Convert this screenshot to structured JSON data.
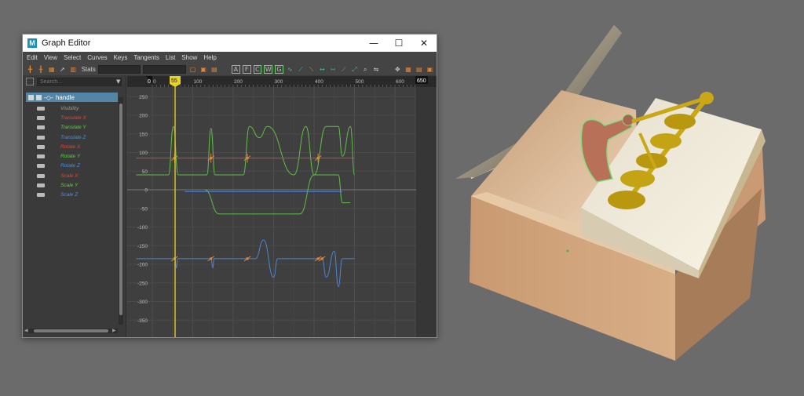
{
  "window": {
    "title": "Graph Editor",
    "app_icon_letter": "M",
    "controls": {
      "minimize": "—",
      "maximize": "☐",
      "close": "✕"
    }
  },
  "menu": [
    "Edit",
    "View",
    "Select",
    "Curves",
    "Keys",
    "Tangents",
    "List",
    "Show",
    "Help"
  ],
  "toolbar": {
    "stats_label": "Stats",
    "green_button_letters": [
      "A",
      "F",
      "C",
      "W",
      "G",
      "S"
    ]
  },
  "outliner": {
    "search_placeholder": "Search...",
    "node": "handle",
    "attributes": [
      {
        "label": "Visibility",
        "color": "#9a9a9a"
      },
      {
        "label": "Translate X",
        "color": "#e0463d"
      },
      {
        "label": "Translate Y",
        "color": "#5fcf3d"
      },
      {
        "label": "Translate Z",
        "color": "#4d8fe3"
      },
      {
        "label": "Rotate X",
        "color": "#e0463d"
      },
      {
        "label": "Rotate Y",
        "color": "#5fcf3d"
      },
      {
        "label": "Rotate Z",
        "color": "#4d8fe3"
      },
      {
        "label": "Scale X",
        "color": "#e0463d"
      },
      {
        "label": "Scale Y",
        "color": "#5fcf3d"
      },
      {
        "label": "Scale Z",
        "color": "#4d8fe3"
      }
    ]
  },
  "graph": {
    "range_start_label": "0",
    "range_end_label": "650",
    "current_frame": "55",
    "x_ticks": [
      "0",
      "100",
      "200",
      "300",
      "400",
      "500",
      "600"
    ],
    "y_ticks": [
      "250",
      "200",
      "150",
      "100",
      "50",
      "0",
      "-50",
      "-100",
      "-150",
      "-200",
      "-250",
      "-300",
      "-350"
    ],
    "colors": {
      "red": "#d24a3a",
      "green": "#5fbf46",
      "blue": "#4a86d6",
      "key": "#e08a3a",
      "playhead": "#d8c21a"
    }
  }
}
